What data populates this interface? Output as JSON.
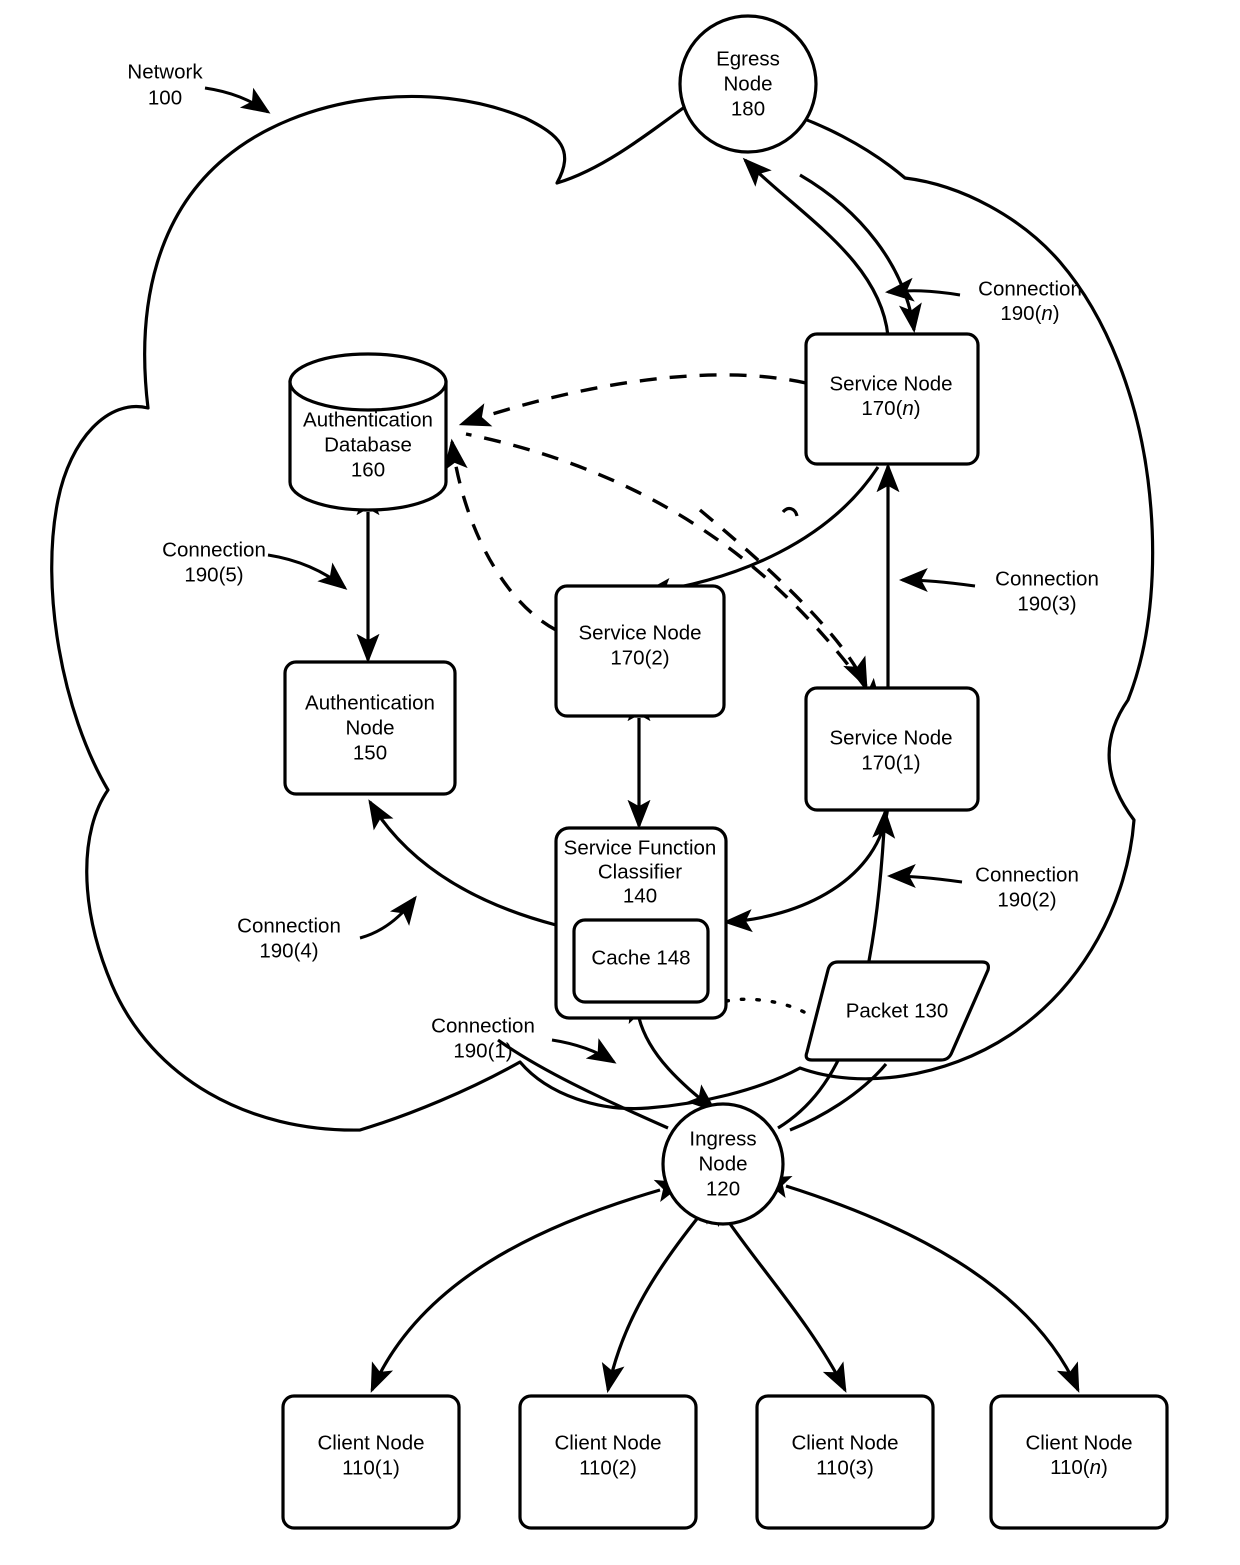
{
  "figure": {
    "title_label": "Network",
    "title_ref": "100"
  },
  "cloud": {
    "name": "network-cloud"
  },
  "nodes": {
    "egress": {
      "line1": "Egress",
      "line2": "Node",
      "ref": "180"
    },
    "ingress": {
      "line1": "Ingress",
      "line2": "Node",
      "ref": "120"
    },
    "auth_db": {
      "line1": "Authentication",
      "line2": "Database",
      "ref": "160"
    },
    "auth_node": {
      "line1": "Authentication",
      "line2": "Node",
      "ref": "150"
    },
    "sfc": {
      "line1": "Service Function",
      "line2": "Classifier",
      "ref": "140"
    },
    "cache": {
      "label": "Cache 148"
    },
    "packet": {
      "label": "Packet 130"
    },
    "service_node_1": {
      "line1": "Service Node",
      "ref": "170(1)",
      "ref_prefix": "170(",
      "ref_italic": "1",
      "ref_suffix": ")"
    },
    "service_node_2": {
      "line1": "Service Node",
      "ref": "170(2)",
      "ref_prefix": "170(",
      "ref_italic": "2",
      "ref_suffix": ")"
    },
    "service_node_n": {
      "line1": "Service Node",
      "ref_prefix": "170(",
      "ref_italic": "n",
      "ref_suffix": ")"
    },
    "client_1": {
      "line1": "Client Node",
      "ref": "110(1)"
    },
    "client_2": {
      "line1": "Client Node",
      "ref": "110(2)"
    },
    "client_3": {
      "line1": "Client Node",
      "ref": "110(3)"
    },
    "client_n": {
      "line1": "Client Node",
      "ref_prefix": "110(",
      "ref_italic": "n",
      "ref_suffix": ")"
    }
  },
  "connections": [
    {
      "id": "c1",
      "line1": "Connection",
      "line2": "190(1)"
    },
    {
      "id": "c2",
      "line1": "Connection",
      "line2": "190(2)"
    },
    {
      "id": "c3",
      "line1": "Connection",
      "line2": "190(3)"
    },
    {
      "id": "c4",
      "line1": "Connection",
      "line2": "190(4)"
    },
    {
      "id": "c5",
      "line1": "Connection",
      "line2": "190(5)"
    },
    {
      "id": "cn",
      "line1": "Connection",
      "line2_prefix": "190(",
      "line2_italic": "n",
      "line2_suffix": ")"
    }
  ],
  "colors": {
    "stroke": "#000000",
    "fill": "#ffffff"
  }
}
